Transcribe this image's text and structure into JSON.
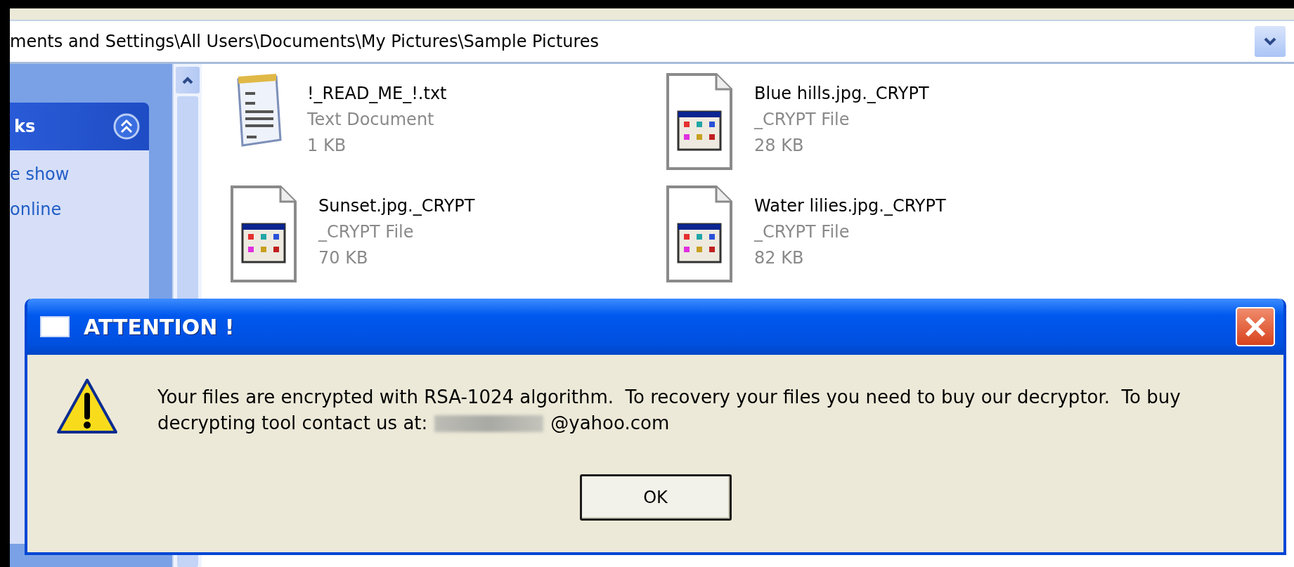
{
  "explorer": {
    "address": "ments and Settings\\All Users\\Documents\\My Pictures\\Sample Pictures",
    "sidebar": {
      "panel_title": "ks",
      "links": [
        "e show",
        "online"
      ]
    },
    "files": [
      {
        "name": "!_READ_ME_!.txt",
        "type": "Text Document",
        "size": "1 KB",
        "kind": "text"
      },
      {
        "name": "Blue hills.jpg._CRYPT",
        "type": "_CRYPT File",
        "size": "28 KB",
        "kind": "unknown"
      },
      {
        "name": "Sunset.jpg._CRYPT",
        "type": "_CRYPT File",
        "size": "70 KB",
        "kind": "unknown"
      },
      {
        "name": "Water lilies.jpg._CRYPT",
        "type": "_CRYPT File",
        "size": "82 KB",
        "kind": "unknown"
      }
    ]
  },
  "dialog": {
    "title": "ATTENTION !",
    "message": [
      "Your files are encrypted with RSA-1024 algorithm.  To recovery your files you need to buy our decryptor.  To buy",
      "decrypting tool contact us at:"
    ],
    "email_domain": "@yahoo.com",
    "buttons": [
      "OK"
    ]
  }
}
